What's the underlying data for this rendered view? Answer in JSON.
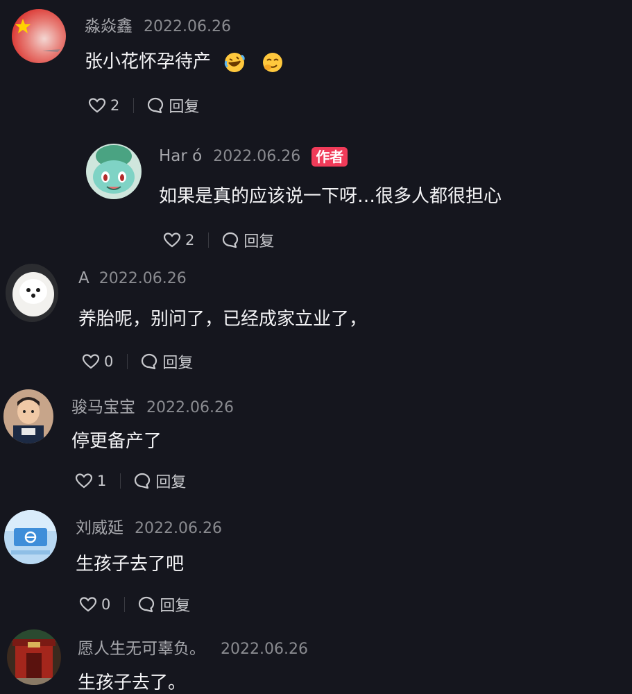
{
  "comments": [
    {
      "username": "淼焱鑫",
      "date": "2022.06.26",
      "text": "张小花怀孕待产",
      "emojis": [
        "rofl-emoji",
        "smirk-emoji"
      ],
      "likes": "2",
      "reply_label": "回复",
      "avatar": "china-flag-avatar"
    },
    {
      "username": "Har ó",
      "date": "2022.06.26",
      "badge": "作者",
      "text": "如果是真的应该说一下呀…很多人都很担心",
      "likes": "2",
      "reply_label": "回复",
      "avatar": "bulbasaur-avatar"
    },
    {
      "username": "A",
      "date": "2022.06.26",
      "text": "养胎呢，别问了，已经成家立业了，",
      "likes": "0",
      "reply_label": "回复",
      "avatar": "pomeranian-dog-avatar"
    },
    {
      "username": "骏马宝宝",
      "date": "2022.06.26",
      "text": "停更备产了",
      "likes": "1",
      "reply_label": "回复",
      "avatar": "child-photo-avatar"
    },
    {
      "username": "刘威延",
      "date": "2022.06.26",
      "text": "生孩子去了吧",
      "likes": "0",
      "reply_label": "回复",
      "avatar": "blue-sign-avatar"
    },
    {
      "username": "愿人生无可辜负。",
      "date": "2022.06.26",
      "text": "生孩子去了。",
      "avatar": "temple-gate-avatar"
    }
  ],
  "colors": {
    "background": "#15161e",
    "badge": "#f03b59",
    "username": "#a6a7ac",
    "text": "#f4f4f6"
  }
}
